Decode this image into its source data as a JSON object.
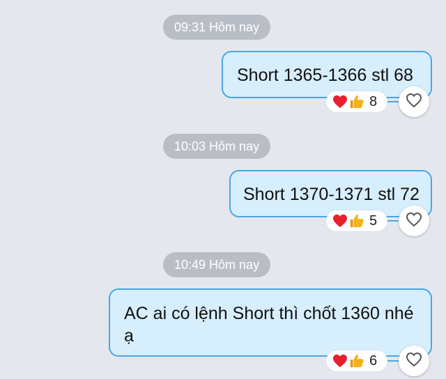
{
  "colors": {
    "background": "#e4e8ee",
    "bubble_fill": "#d7eefc",
    "bubble_border": "#4aa6e6",
    "time_chip": "#b9bec6",
    "heart": "#e8202e",
    "thumb": "#f3b21c"
  },
  "messages": [
    {
      "time": "09:31 Hôm nay",
      "text": "Short 1365-1366 stl 68",
      "reactions": [
        "heart-icon",
        "thumbs-up-icon"
      ],
      "reaction_count": "8"
    },
    {
      "time": "10:03 Hôm nay",
      "text": "Short 1370-1371 stl 72",
      "reactions": [
        "heart-icon",
        "thumbs-up-icon"
      ],
      "reaction_count": "5"
    },
    {
      "time": "10:49 Hôm nay",
      "text_line1": "AC ai có lệnh Short thì chốt 1360 nhé",
      "text_line2": "ạ",
      "reactions": [
        "heart-icon",
        "thumbs-up-icon"
      ],
      "reaction_count": "6"
    }
  ],
  "icons": {
    "like_button": "heart-outline-icon"
  }
}
